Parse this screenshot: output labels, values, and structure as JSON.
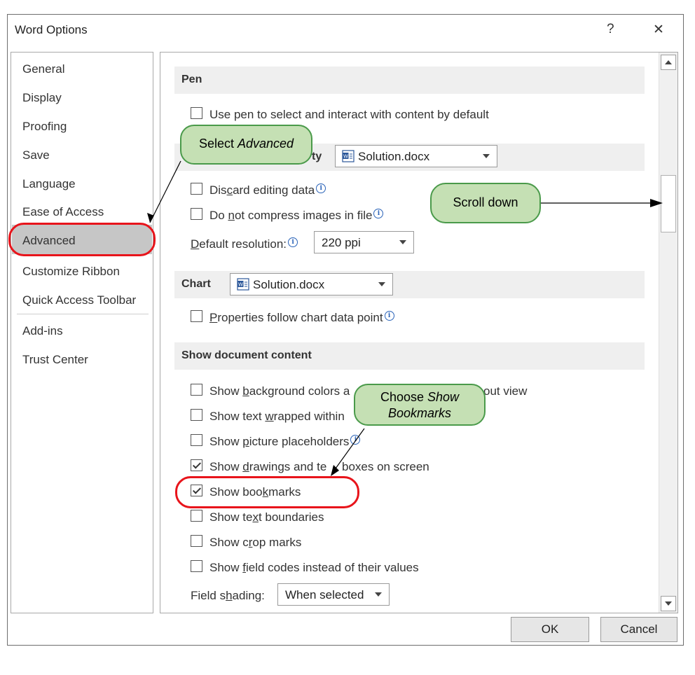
{
  "window": {
    "title": "Word Options",
    "help": "?",
    "close": "✕"
  },
  "nav": {
    "items": [
      "General",
      "Display",
      "Proofing",
      "Save",
      "Language",
      "Ease of Access",
      "Advanced",
      "Customize Ribbon",
      "Quick Access Toolbar",
      "Add-ins",
      "Trust Center"
    ],
    "selected": "Advanced"
  },
  "pen": {
    "header": "Pen",
    "use_pen": "Use pen to select and interact with content by default"
  },
  "image_size": {
    "header_fragment": "ty",
    "doc": "Solution.docx",
    "discard_pre": "Dis",
    "discard_u": "c",
    "discard_post": "ard editing data",
    "compress_pre": "Do ",
    "compress_u": "n",
    "compress_post": "ot compress images in file",
    "resolution_u": "D",
    "resolution_post": "efault resolution:",
    "resolution_value": "220 ppi"
  },
  "chart": {
    "header": "Chart",
    "doc": "Solution.docx",
    "props_u": "P",
    "props_post": "roperties follow chart data point"
  },
  "show_content": {
    "header": "Show document content",
    "bg_pre": "Show ",
    "bg_u": "b",
    "bg_post": "ackground colors a",
    "bg_tail": "out view",
    "wrap_pre": "Show text ",
    "wrap_u": "w",
    "wrap_post": "rapped within",
    "pic_pre": "Show ",
    "pic_u": "p",
    "pic_post": "icture placeholders",
    "draw_pre": "Show ",
    "draw_u": "d",
    "draw_post": "rawings and te",
    "draw_tail": "boxes on screen",
    "bm_pre": "Show boo",
    "bm_u": "k",
    "bm_post": "marks",
    "tb_pre": "Show te",
    "tb_u": "x",
    "tb_post": "t boundaries",
    "crop_pre": "Show c",
    "crop_u": "r",
    "crop_post": "op marks",
    "field_pre": "Show ",
    "field_u": "f",
    "field_post": "ield codes instead of their values",
    "shading_pre": "Field s",
    "shading_u": "h",
    "shading_post": "ading:",
    "shading_value": "When selected",
    "checked": {
      "drawings": true,
      "bookmarks": true
    }
  },
  "buttons": {
    "ok": "OK",
    "cancel": "Cancel"
  },
  "callouts": {
    "select_pre": "Select ",
    "select_em": "Advanced",
    "scroll": "Scroll down",
    "choose_pre": "Choose ",
    "choose_em1": "Show",
    "choose_em2": "Bookmarks"
  },
  "colors": {
    "callout_fill": "#c5e0b4",
    "callout_border": "#4a9a4a",
    "highlight_ring": "#e8141b",
    "selected_nav": "#c6c6c6"
  }
}
